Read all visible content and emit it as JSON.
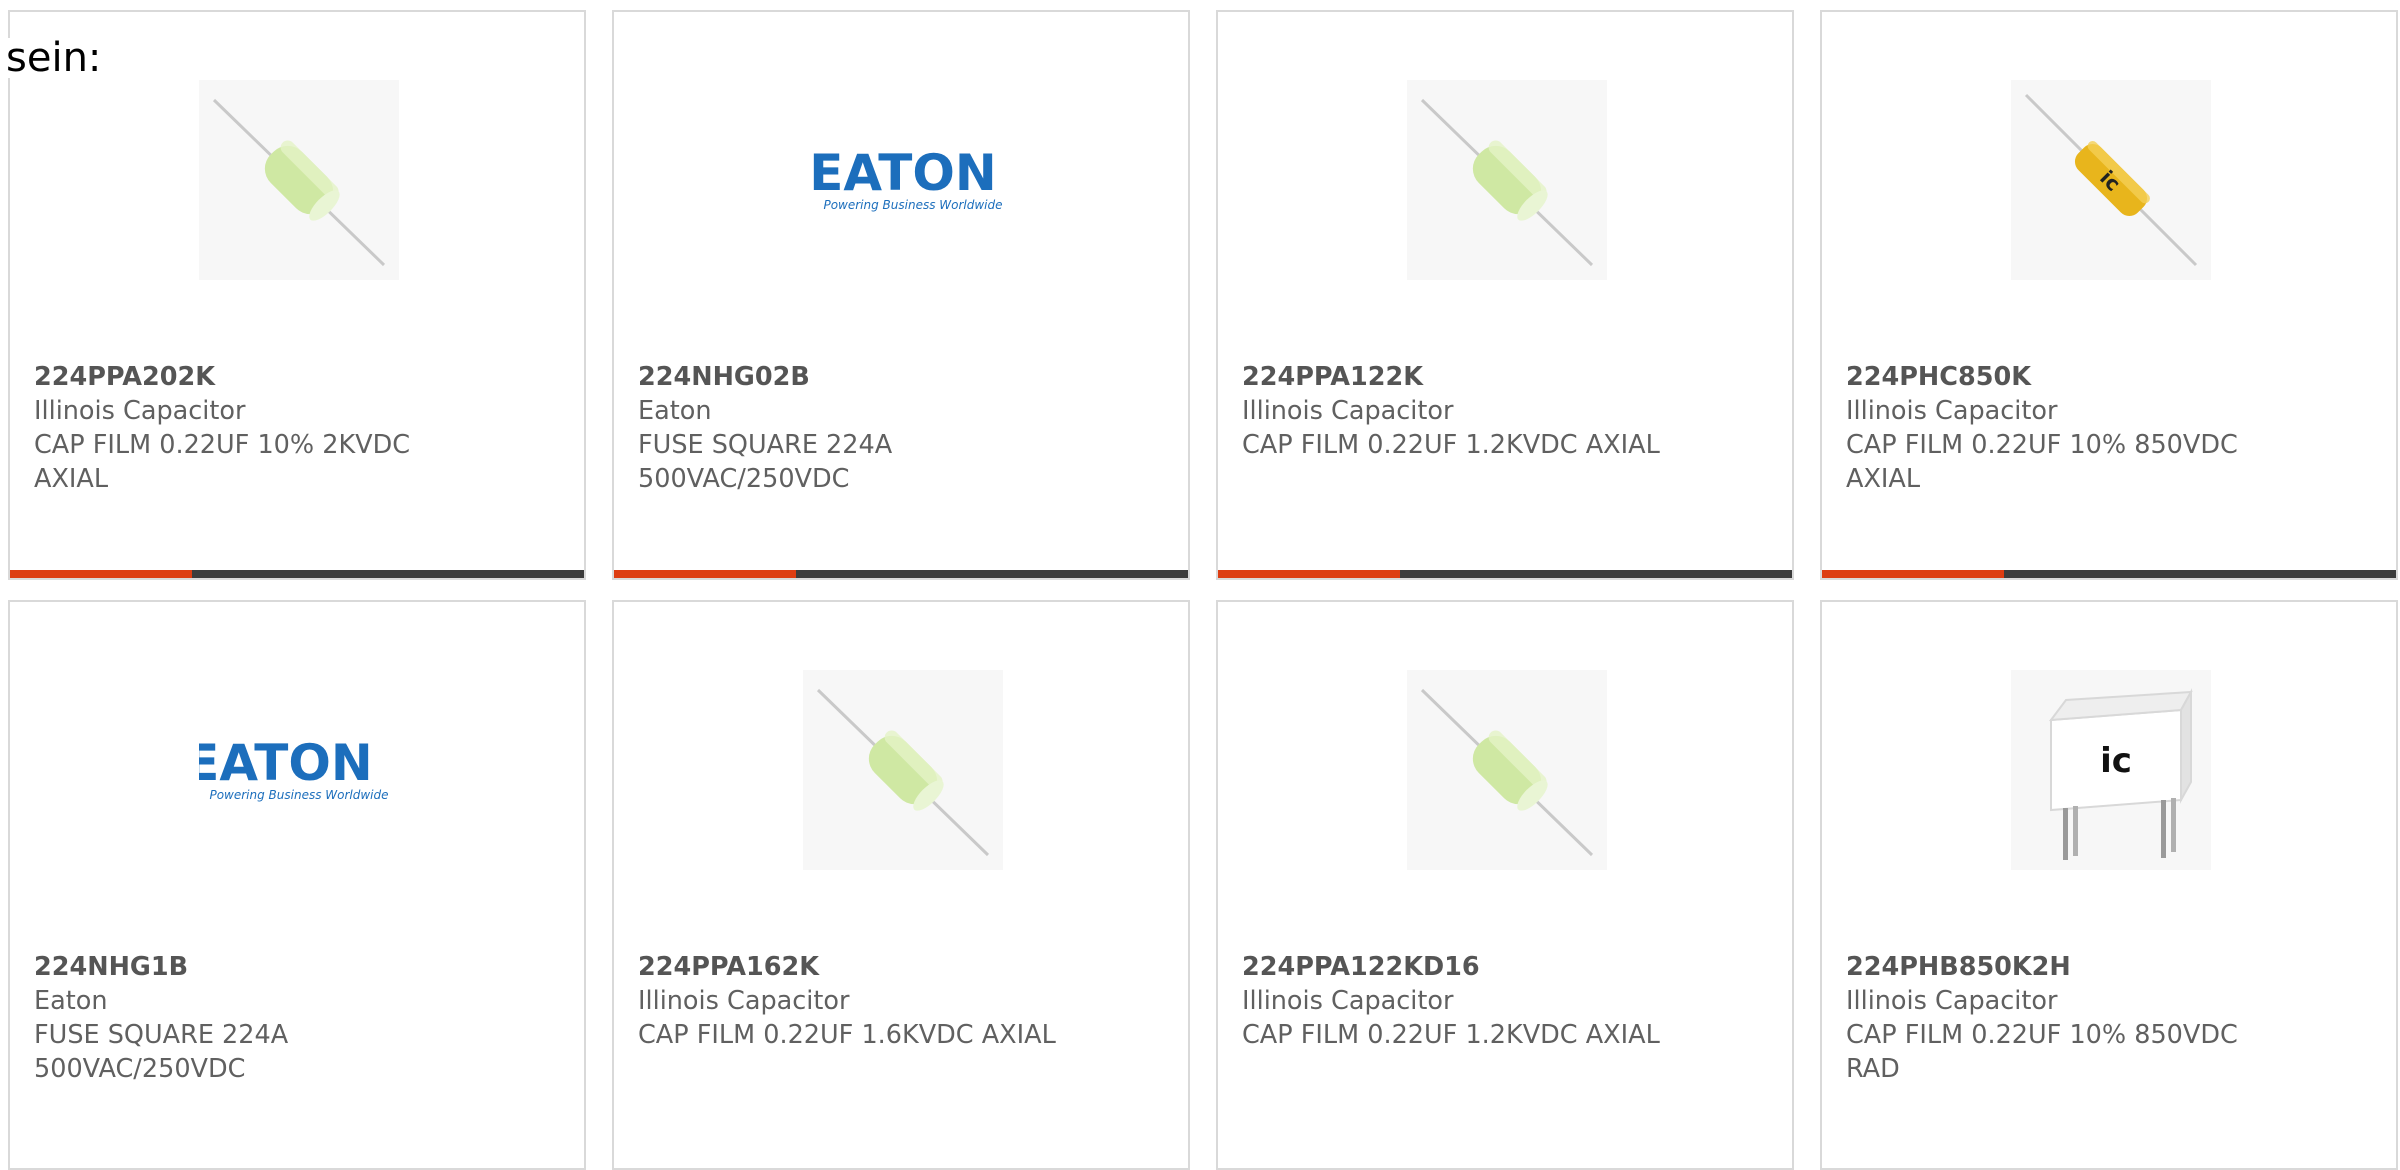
{
  "page": {
    "lead_text": "sein:"
  },
  "colors": {
    "accent": "#dd3d12",
    "bar": "#3c3c3c",
    "eaton_blue": "#1c6ebc",
    "text": "#606060"
  },
  "products": [
    {
      "part_number": "224PPA202K",
      "manufacturer": "Illinois Capacitor",
      "desc1": "CAP FILM 0.22UF 10% 2KVDC",
      "desc2": "AXIAL",
      "image": "green-axial-capacitor"
    },
    {
      "part_number": "224NHG02B",
      "manufacturer": "Eaton",
      "desc1": "FUSE SQUARE 224A",
      "desc2": "500VAC/250VDC",
      "image": "eaton-logo"
    },
    {
      "part_number": "224PPA122K",
      "manufacturer": "Illinois Capacitor",
      "desc1": "CAP FILM 0.22UF 1.2KVDC AXIAL",
      "desc2": "",
      "image": "green-axial-capacitor"
    },
    {
      "part_number": "224PHC850K",
      "manufacturer": "Illinois Capacitor",
      "desc1": "CAP FILM 0.22UF 10% 850VDC",
      "desc2": "AXIAL",
      "image": "yellow-axial-capacitor"
    },
    {
      "part_number": "224NHG1B",
      "manufacturer": "Eaton",
      "desc1": "FUSE SQUARE 224A",
      "desc2": "500VAC/250VDC",
      "image": "eaton-logo"
    },
    {
      "part_number": "224PPA162K",
      "manufacturer": "Illinois Capacitor",
      "desc1": "CAP FILM 0.22UF 1.6KVDC AXIAL",
      "desc2": "",
      "image": "green-axial-capacitor"
    },
    {
      "part_number": "224PPA122KD16",
      "manufacturer": "Illinois Capacitor",
      "desc1": "CAP FILM 0.22UF 1.2KVDC AXIAL",
      "desc2": "",
      "image": "green-axial-capacitor"
    },
    {
      "part_number": "224PHB850K2H",
      "manufacturer": "Illinois Capacitor",
      "desc1": "CAP FILM 0.22UF 10% 850VDC",
      "desc2": "RAD",
      "image": "radial-box-capacitor"
    }
  ],
  "logos": {
    "eaton_word": "EATON",
    "eaton_tagline": "Powering Business Worldwide",
    "ic_mark": "ic"
  }
}
